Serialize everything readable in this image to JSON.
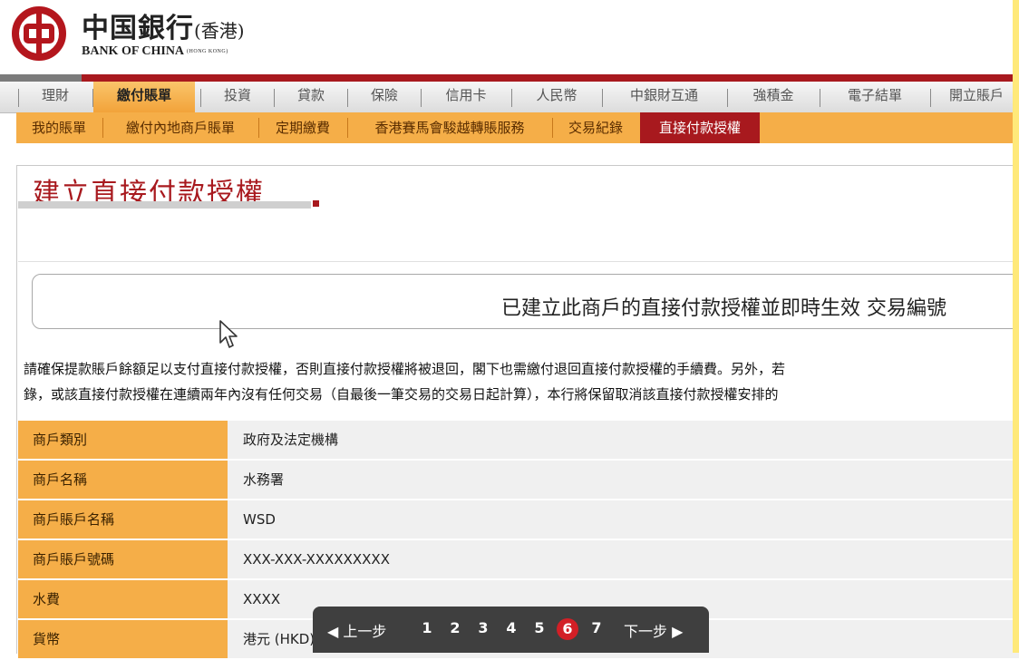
{
  "brand": {
    "name_cn": "中国銀行",
    "region_cn": "(香港)",
    "name_en": "BANK OF CHINA",
    "region_en": "(HONG KONG)"
  },
  "main_nav": [
    "理財",
    "繳付賬單",
    "投資",
    "貸款",
    "保險",
    "信用卡",
    "人民幣",
    "中銀財互通",
    "強積金",
    "電子結單",
    "開立賬戶"
  ],
  "main_nav_active": "繳付賬單",
  "sub_nav": [
    "我的賬單",
    "繳付內地商戶賬單",
    "定期繳費",
    "香港賽馬會駿越轉賬服務",
    "交易紀錄",
    "直接付款授權"
  ],
  "sub_nav_active": "直接付款授權",
  "page_title": "建立直接付款授權",
  "confirmation": "已建立此商戶的直接付款授權並即時生效 交易編號",
  "notice_lines": [
    "請確保提款賬戶餘額足以支付直接付款授權，否則直接付款授權將被退回，閣下也需繳付退回直接付款授權的手續費。另外，若",
    "錄，或該直接付款授權在連續兩年內沒有任何交易（自最後一筆交易的交易日起計算），本行將保留取消該直接付款授權安排的"
  ],
  "details": [
    {
      "label": "商戶類別",
      "value": "政府及法定機構"
    },
    {
      "label": "商戶名稱",
      "value": "水務署"
    },
    {
      "label": "商戶賬戶名稱",
      "value": "WSD"
    },
    {
      "label": "商戶賬戶號碼",
      "value": "XXX-XXX-XXXXXXXXX"
    },
    {
      "label": "水費",
      "value": "XXXX"
    },
    {
      "label": "貨幣",
      "value": "港元 (HKD)"
    }
  ],
  "pager": {
    "prev_label": "上一步",
    "next_label": "下一步",
    "pages": [
      "1",
      "2",
      "3",
      "4",
      "5",
      "6",
      "7"
    ],
    "current": "6"
  },
  "colors": {
    "brand_red": "#a8191e",
    "nav_orange": "#f5ae48",
    "pager_bg": "#3f3f3f",
    "pager_current": "#d21f26"
  },
  "icons": [
    "bank-of-china-logo",
    "mouse-cursor-icon",
    "triangle-left-icon",
    "triangle-right-icon"
  ]
}
